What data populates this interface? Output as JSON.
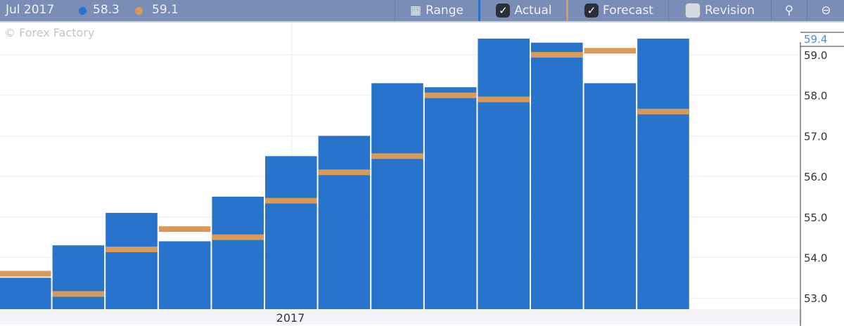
{
  "header": {
    "period": "Jul 2017",
    "actual_value": "58.3",
    "forecast_value": "59.1"
  },
  "toolbar": {
    "range": "Range",
    "actual": "Actual",
    "actual_checked": true,
    "forecast": "Forecast",
    "forecast_checked": true,
    "revision": "Revision",
    "revision_checked": false
  },
  "watermark": "© Forex Factory",
  "colors": {
    "actual": "#2874cc",
    "forecast": "#d89a58",
    "toolbar": "#7a8db6"
  },
  "chart_data": {
    "type": "bar",
    "series": [
      {
        "name": "Actual",
        "values": [
          53.5,
          54.3,
          55.1,
          54.4,
          55.5,
          56.5,
          57.0,
          58.3,
          58.2,
          59.4,
          59.3,
          58.3,
          59.4
        ]
      },
      {
        "name": "Forecast",
        "values": [
          53.6,
          53.1,
          54.2,
          54.7,
          54.5,
          55.4,
          56.1,
          56.5,
          58.0,
          57.9,
          59.0,
          59.1,
          57.6
        ]
      }
    ],
    "x_label": "2017",
    "y_ticks": [
      "59.0",
      "58.0",
      "57.0",
      "56.0",
      "55.0",
      "54.0",
      "53.0"
    ],
    "last_value_label": "59.4",
    "ylim": [
      52.75,
      59.4
    ],
    "grid": true
  }
}
